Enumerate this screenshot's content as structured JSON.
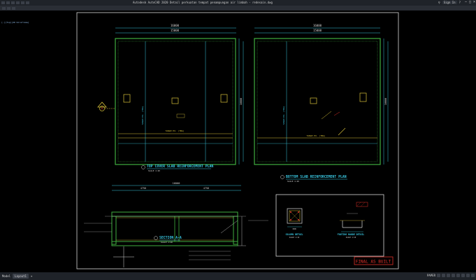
{
  "app": {
    "window_title": "Autodesk AutoCAD 2020    Detail perkuatan tempat penampungan air limbah - redesain.dwg",
    "sign_in": "Sign In",
    "viewport_control": "[-][Top][2D Wireframe]"
  },
  "drawing": {
    "top_plan": {
      "title": "TOP COVER SLAB REINFORCEMENT PLAN",
      "scale": "SCALE  1:40",
      "overall_dim": "16000",
      "inner_dim": "15000",
      "side_dim": "10000",
      "side_inner_dim": "9000",
      "tangga_label": "TANGGA",
      "note_label": "TANAH EX. (TBA)",
      "section_mark": "A"
    },
    "bottom_plan": {
      "title": "BOTTOM SLAB REINFORCEMENT PLAN",
      "scale": "SCALE  1:40",
      "overall_dim": "16000",
      "inner_dim": "15000",
      "side_dim": "10000",
      "side_inner_dim": "9000",
      "note_label": "TANAH EX. (TBA)"
    },
    "section": {
      "title": "SECTION A-A",
      "scale": "SCALE  1:40",
      "dim_total": "16000",
      "dim_left": "4750",
      "dim_right": "4750"
    },
    "column_detail": {
      "title": "COLUMN DETAIL",
      "scale": "SCALE  1:10",
      "dim": "300"
    },
    "footing_detail": {
      "title": "FOOTING BANDE DETAIL",
      "scale": "SCALE  1:10"
    },
    "stamp": "FINAL AS BUILT"
  },
  "status": {
    "tabs": [
      "Model",
      "Layout1"
    ],
    "active_tab": "Layout1",
    "paper": "PAPER"
  },
  "colors": {
    "line_green": "#3fae3f",
    "line_yellow": "#d8c23a",
    "line_cyan": "#39c6e0",
    "line_white": "#d8d8d8",
    "accent_red": "#e0302a",
    "dim_magenta": "#c14bd6"
  }
}
